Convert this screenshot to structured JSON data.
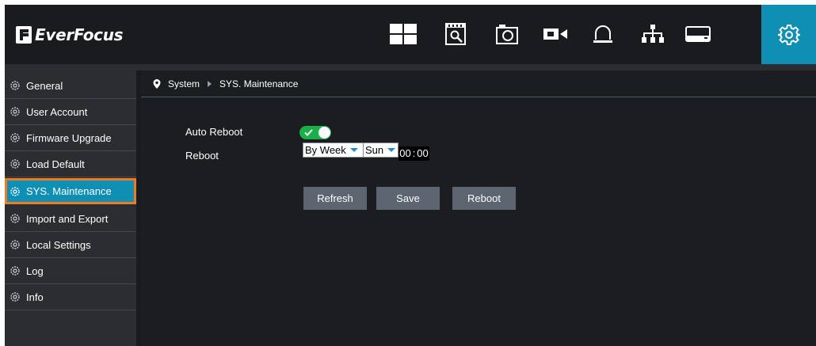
{
  "app": {
    "brand": "EverFocus"
  },
  "header": {
    "nav": [
      {
        "name": "live-view-icon"
      },
      {
        "name": "playback-icon"
      },
      {
        "name": "snapshot-icon"
      },
      {
        "name": "record-icon"
      },
      {
        "name": "alarm-icon"
      },
      {
        "name": "network-icon"
      },
      {
        "name": "storage-icon"
      },
      {
        "name": "system-settings-icon",
        "active": true
      }
    ],
    "active_color": "#0f8fb3"
  },
  "sidebar": {
    "items": [
      {
        "label": "General"
      },
      {
        "label": "User Account"
      },
      {
        "label": "Firmware Upgrade"
      },
      {
        "label": "Load Default"
      },
      {
        "label": "SYS. Maintenance",
        "selected": true
      },
      {
        "label": "Import and Export"
      },
      {
        "label": "Local Settings"
      },
      {
        "label": "Log"
      },
      {
        "label": "Info"
      }
    ],
    "selected_highlight": "#ee7a24"
  },
  "breadcrumb": {
    "root": "System",
    "current": "SYS. Maintenance"
  },
  "form": {
    "auto_reboot": {
      "label": "Auto Reboot",
      "enabled": true
    },
    "reboot": {
      "label": "Reboot",
      "frequency": "By Week",
      "day": "Sun",
      "hour": "00",
      "time_sep": ":",
      "minute": "00"
    }
  },
  "buttons": {
    "refresh": "Refresh",
    "save": "Save",
    "reboot": "Reboot"
  },
  "colors": {
    "toggle_on": "#19b04a",
    "button": "#5c6570",
    "accent": "#0f8fb3"
  }
}
